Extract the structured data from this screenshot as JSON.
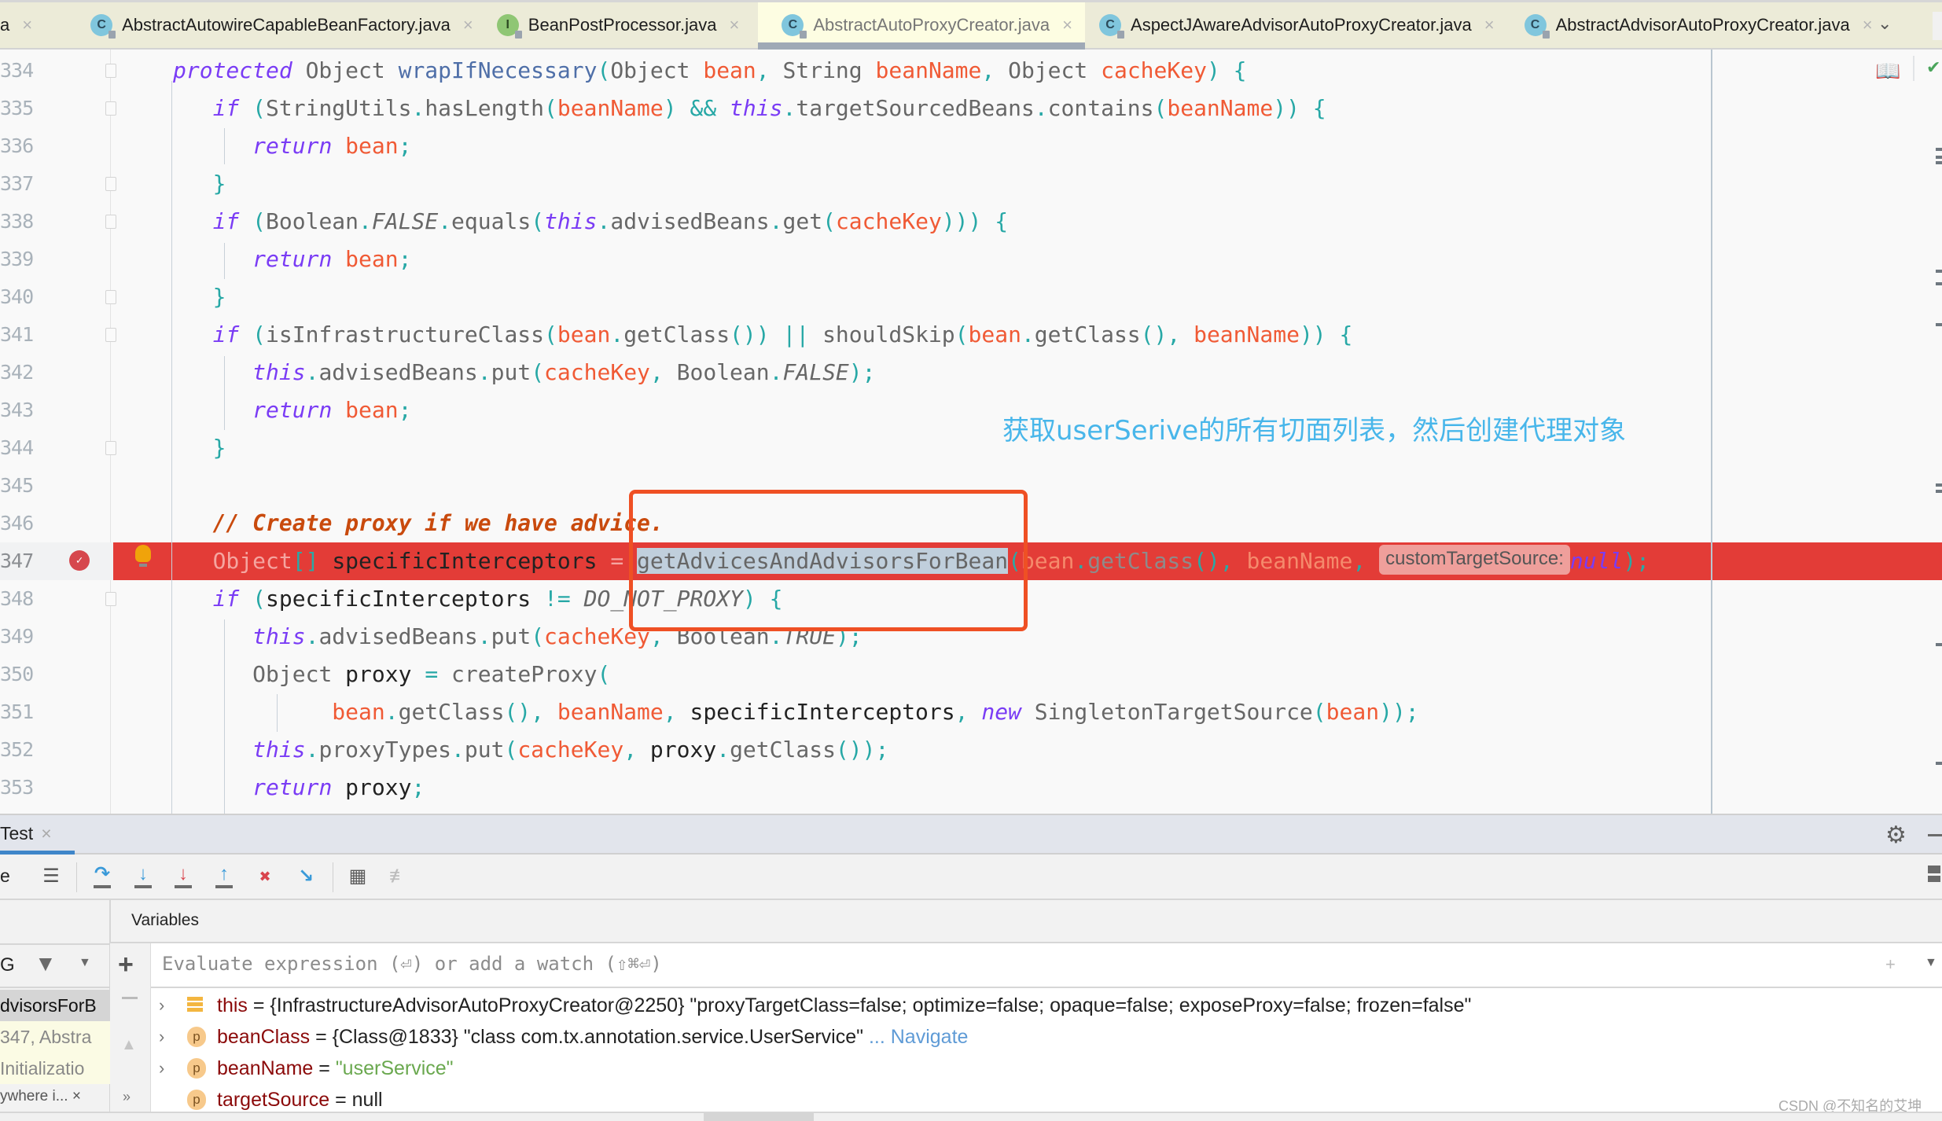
{
  "tabs": [
    {
      "label": "a",
      "icon": "",
      "active": false,
      "partial": true
    },
    {
      "label": "AbstractAutowireCapableBeanFactory.java",
      "icon": "C",
      "active": false
    },
    {
      "label": "BeanPostProcessor.java",
      "icon": "I",
      "active": false
    },
    {
      "label": "AbstractAutoProxyCreator.java",
      "icon": "C",
      "active": true
    },
    {
      "label": "AspectJAwareAdvisorAutoProxyCreator.java",
      "icon": "C",
      "active": false
    },
    {
      "label": "AbstractAdvisorAutoProxyCreator.java",
      "icon": "C",
      "active": false
    }
  ],
  "tab_close_glyph": "×",
  "tab_overflow_glyph": "⌄",
  "editor": {
    "line_numbers": [
      "334",
      "335",
      "336",
      "337",
      "338",
      "339",
      "340",
      "341",
      "342",
      "343",
      "344",
      "345",
      "346",
      "347",
      "348",
      "349",
      "350",
      "351",
      "352",
      "353"
    ],
    "breakpoint_line": "347",
    "annotation": "获取userSerive的所有切面列表，然后创建代理对象",
    "inlay_hint": "customTargetSource:",
    "highlighted_method": "getAdvicesAndAdvisorsForBean",
    "comment": "// Create proxy if we have advice.",
    "icons": {
      "reader_mode": "📖",
      "inspection_ok": "✔",
      "breakpoint": "✓"
    }
  },
  "debug": {
    "session_tab": "Test",
    "session_close": "×",
    "toolbar_label": "e",
    "toolbar_buttons": [
      {
        "name": "layout",
        "glyph": "☰"
      },
      {
        "name": "step-over",
        "glyph": "↷"
      },
      {
        "name": "step-into",
        "glyph": "↓"
      },
      {
        "name": "force-step-into",
        "glyph": "↓"
      },
      {
        "name": "step-out",
        "glyph": "↑"
      },
      {
        "name": "drop-frame",
        "glyph": "✖"
      },
      {
        "name": "run-to-cursor",
        "glyph": "↘"
      },
      {
        "name": "evaluate-expression",
        "glyph": "▦"
      },
      {
        "name": "trace",
        "glyph": "≢"
      }
    ],
    "variables_title": "Variables",
    "frames_filter_label": "G",
    "frames": [
      {
        "label": "dvisorsForB",
        "style": "selected"
      },
      {
        "label": "347, Abstra",
        "style": "library"
      },
      {
        "label": "Initializatio",
        "style": "library"
      },
      {
        "label": "ywhere i... ×",
        "style": "hint"
      }
    ],
    "eval_placeholder": "Evaluate expression (⏎) or add a watch (⇧⌘⏎)",
    "variables": [
      {
        "icon": "this",
        "name": "this",
        "eq": " = ",
        "value": "{InfrastructureAdvisorAutoProxyCreator@2250} \"proxyTargetClass=false; optimize=false; opaque=false; exposeProxy=false; frozen=false\"",
        "expandable": true
      },
      {
        "icon": "p",
        "name": "beanClass",
        "eq": " = ",
        "value": "{Class@1833} \"class com.tx.annotation.service.UserService\"",
        "link": " ... Navigate",
        "expandable": true
      },
      {
        "icon": "p",
        "name": "beanName",
        "eq": " = ",
        "value_string": "\"userService\"",
        "expandable": true
      },
      {
        "icon": "p",
        "name": "targetSource",
        "eq": " = ",
        "value": "null",
        "expandable": false
      }
    ]
  },
  "watermark": "CSDN @不知名的艾坤",
  "colors": {
    "breakpoint_line": "#e33c37",
    "annotation_box": "#ef5024",
    "annotation_text": "#48b6ea",
    "keyword": "#7a3cf5",
    "param": "#f05a35",
    "active_tab": "#fdfde2"
  }
}
